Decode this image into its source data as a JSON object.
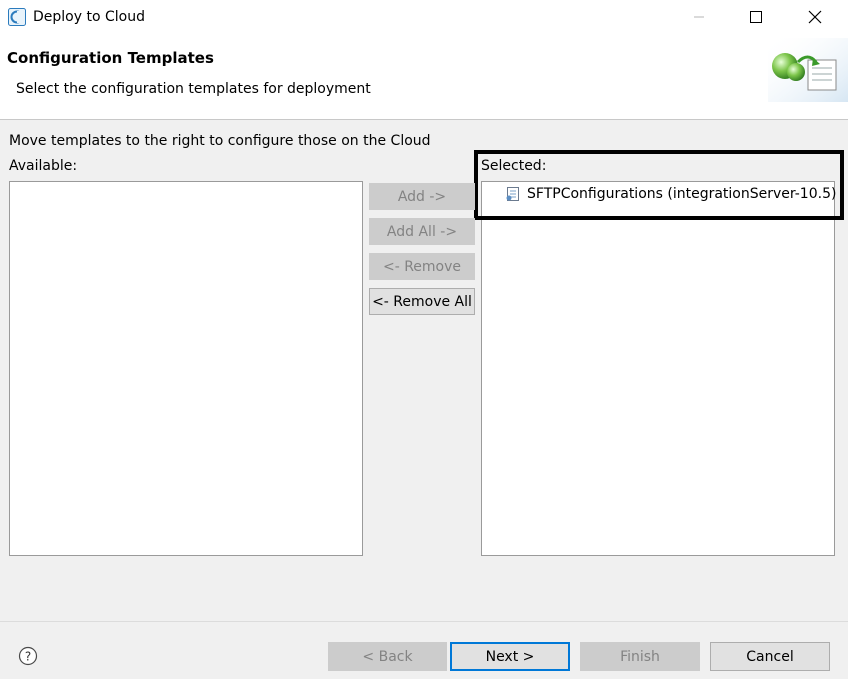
{
  "window": {
    "title": "Deploy to Cloud",
    "controls": {
      "minimize": "minimize-icon",
      "maximize": "maximize-icon",
      "close": "close-icon"
    }
  },
  "header": {
    "title": "Configuration Templates",
    "description": "Select the configuration templates for deployment"
  },
  "body": {
    "instruction": "Move templates to the right to configure those on the Cloud",
    "available_label": "Available:",
    "available_items": [],
    "selected_label": "Selected:",
    "selected_items": [
      {
        "label": "SFTPConfigurations  (integrationServer-10.5)",
        "icon": "config-file-icon"
      }
    ]
  },
  "move_buttons": {
    "add": "Add ->",
    "add_all": "Add All ->",
    "remove": "<- Remove",
    "remove_all": "<- Remove All"
  },
  "footer": {
    "back": "< Back",
    "next": "Next >",
    "finish": "Finish",
    "cancel": "Cancel",
    "help_icon": "help-icon"
  }
}
